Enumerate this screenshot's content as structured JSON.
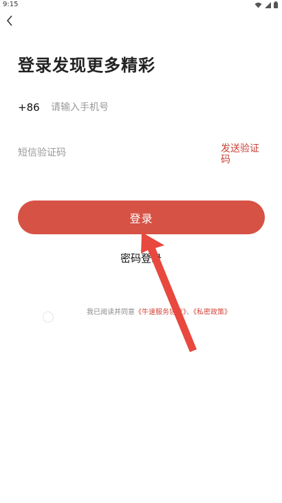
{
  "status_bar": {
    "time": "9:15",
    "icons": [
      "wifi-icon",
      "signal-icon",
      "battery-icon"
    ]
  },
  "header": {
    "back_icon": "chevron-left-icon"
  },
  "title": "登录发现更多精彩",
  "phone": {
    "country_code": "+86",
    "placeholder": "请输入手机号"
  },
  "sms": {
    "placeholder": "短信验证码",
    "send_code_label": "发送验证码"
  },
  "login_button_label": "登录",
  "password_login_label": "密码登录",
  "agreement": {
    "prefix": "我已阅读并同意",
    "terms_link": "《牛速服务协议》",
    "separator": "、",
    "privacy_link": "《私密政策》"
  },
  "colors": {
    "accent": "#d65245",
    "link": "#d0453a",
    "arrow": "#e8483e"
  }
}
